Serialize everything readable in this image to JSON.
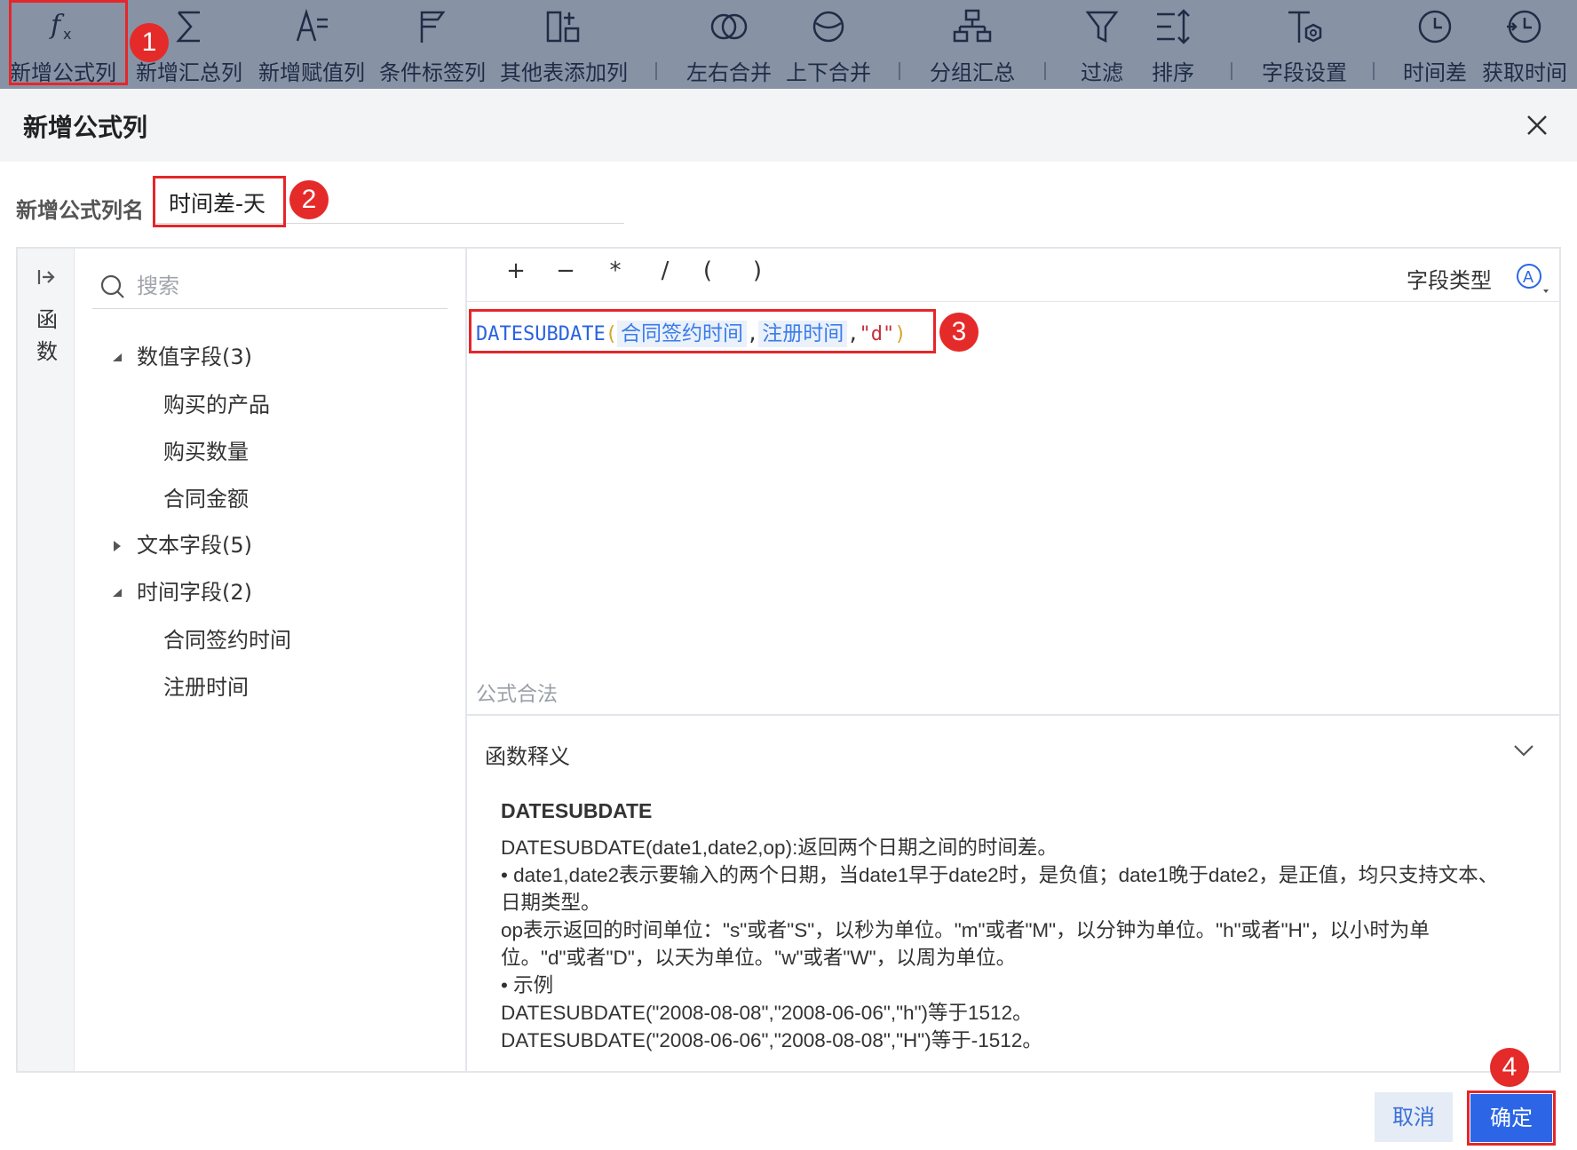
{
  "toolbar": {
    "items": [
      {
        "label": "新增公式列",
        "icon": "formula-fx-icon"
      },
      {
        "label": "新增汇总列",
        "icon": "sigma-icon"
      },
      {
        "label": "新增赋值列",
        "icon": "assign-icon"
      },
      {
        "label": "条件标签列",
        "icon": "flag-icon"
      },
      {
        "label": "其他表添加列",
        "icon": "add-column-icon"
      },
      {
        "label": "左右合并",
        "icon": "merge-horizontal-icon"
      },
      {
        "label": "上下合并",
        "icon": "merge-vertical-icon"
      },
      {
        "label": "分组汇总",
        "icon": "group-tree-icon"
      },
      {
        "label": "过滤",
        "icon": "filter-icon"
      },
      {
        "label": "排序",
        "icon": "sort-icon"
      },
      {
        "label": "字段设置",
        "icon": "field-settings-icon"
      },
      {
        "label": "时间差",
        "icon": "clock-icon"
      },
      {
        "label": "获取时间",
        "icon": "clock-arrow-icon"
      }
    ]
  },
  "badges": {
    "b1": "1",
    "b2": "2",
    "b3": "3",
    "b4": "4"
  },
  "dialog": {
    "title": "新增公式列",
    "name_label": "新增公式列名",
    "name_value": "时间差-天",
    "side_label_1": "函",
    "side_label_2": "数",
    "search_placeholder": "搜索",
    "tree": {
      "group_numeric": "数值字段(3)",
      "numeric_fields": [
        "购买的产品",
        "购买数量",
        "合同金额"
      ],
      "group_text": "文本字段(5)",
      "group_time": "时间字段(2)",
      "time_fields": [
        "合同签约时间",
        "注册时间"
      ]
    },
    "operators": [
      "+",
      "−",
      "*",
      "/",
      "(",
      ")"
    ],
    "field_type_label": "字段类型",
    "formula": {
      "func": "DATESUBDATE",
      "open": "(",
      "arg1": "合同签约时间",
      "comma1": ",",
      "arg2": "注册时间",
      "comma2": ",",
      "arg3": "\"d\"",
      "close": ")"
    },
    "validation": "公式合法",
    "explain": {
      "title": "函数释义",
      "fn_name": "DATESUBDATE",
      "lines": [
        "DATESUBDATE(date1,date2,op):返回两个日期之间的时间差。",
        "• date1,date2表示要输入的两个日期，当date1早于date2时，是负值；date1晚于date2，是正值，均只支持文本、日期类型。",
        "op表示返回的时间单位：\"s\"或者\"S\"，以秒为单位。\"m\"或者\"M\"，以分钟为单位。\"h\"或者\"H\"，以小时为单位。\"d\"或者\"D\"，以天为单位。\"w\"或者\"W\"，以周为单位。",
        "• 示例",
        "DATESUBDATE(\"2008-08-08\",\"2008-06-06\",\"h\")等于1512。",
        "DATESUBDATE(\"2008-06-06\",\"2008-08-08\",\"H\")等于-1512。"
      ]
    },
    "cancel_label": "取消",
    "ok_label": "确定"
  },
  "colors": {
    "toolbar_bg": "#8792a5",
    "accent_blue": "#2c66e6",
    "annotation_red": "#e5262a"
  }
}
